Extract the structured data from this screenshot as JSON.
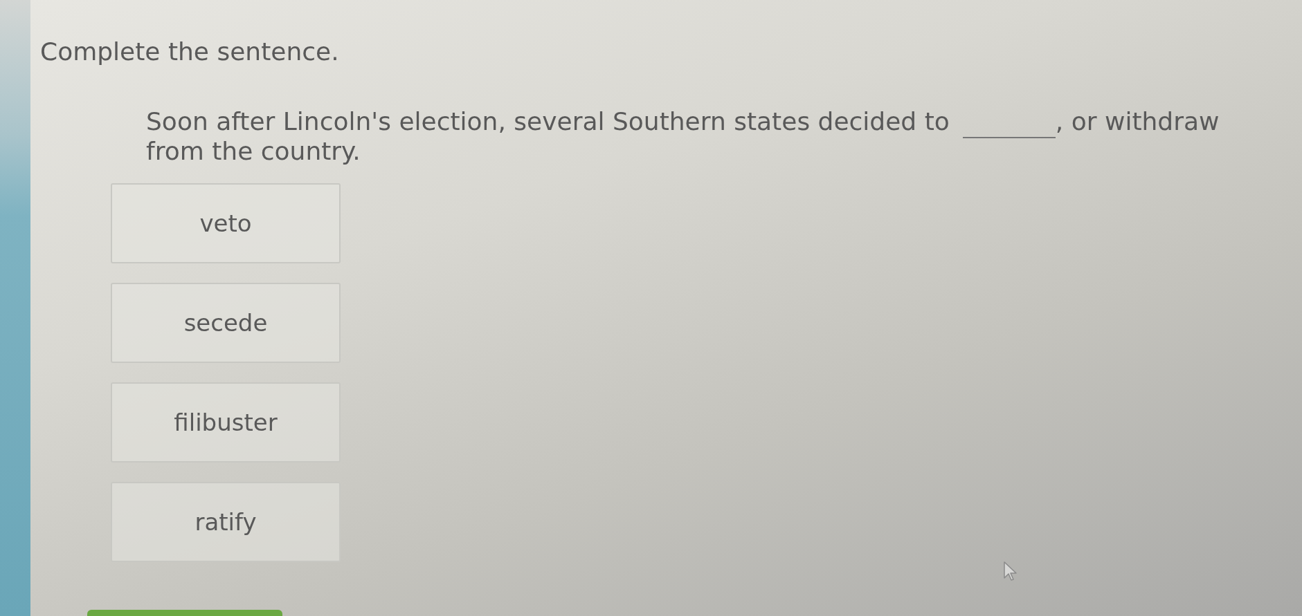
{
  "instruction": "Complete the sentence.",
  "sentence": {
    "before_blank": "Soon after Lincoln's election, several Southern states decided to",
    "after_blank": [
      ", or withdraw",
      "from the country."
    ]
  },
  "choices": [
    {
      "label": "veto",
      "selected": false
    },
    {
      "label": "secede",
      "selected": false
    },
    {
      "label": "filibuster",
      "selected": false
    },
    {
      "label": "ratify",
      "selected": false
    }
  ]
}
